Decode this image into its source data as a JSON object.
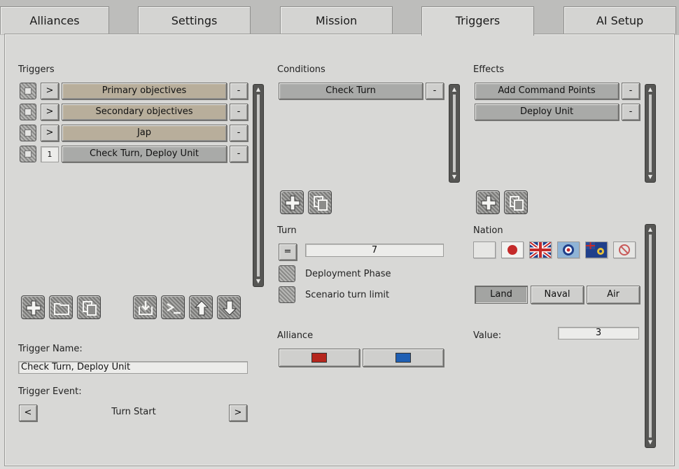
{
  "tabs": [
    {
      "label": "Alliances",
      "active": false
    },
    {
      "label": "Settings",
      "active": false
    },
    {
      "label": "Mission",
      "active": false
    },
    {
      "label": "Triggers",
      "active": true
    },
    {
      "label": "AI Setup",
      "active": false
    }
  ],
  "triggers": {
    "heading": "Triggers",
    "rows": [
      {
        "indicator": ">",
        "name": "Primary objectives",
        "remove": "-"
      },
      {
        "indicator": ">",
        "name": "Secondary objectives",
        "remove": "-"
      },
      {
        "indicator": ">",
        "name": "Jap",
        "remove": "-"
      },
      {
        "indicator": "1",
        "name": "Check Turn, Deploy Unit",
        "remove": "-"
      }
    ],
    "name_label": "Trigger Name:",
    "name_value": "Check Turn, Deploy Unit",
    "event_label": "Trigger Event:",
    "event_prev": "<",
    "event_value": "Turn Start",
    "event_next": ">"
  },
  "conditions": {
    "heading": "Conditions",
    "rows": [
      {
        "name": "Check Turn",
        "remove": "-"
      }
    ]
  },
  "effects": {
    "heading": "Effects",
    "rows": [
      {
        "name": "Add Command Points",
        "remove": "-"
      },
      {
        "name": "Deploy Unit",
        "remove": "-"
      }
    ]
  },
  "turn": {
    "heading": "Turn",
    "operator": "=",
    "value": "7",
    "deployment_phase": "Deployment Phase",
    "scenario_turn_limit": "Scenario turn limit"
  },
  "alliance": {
    "heading": "Alliance",
    "colors": [
      "#b5261d",
      "#1f5fb3"
    ]
  },
  "nation": {
    "heading": "Nation",
    "flags": [
      "blank-flag",
      "japan-flag",
      "uk-flag",
      "raf-roundel-flag",
      "new-zealand-flag",
      "none-flag"
    ],
    "domains": [
      {
        "label": "Land",
        "selected": true
      },
      {
        "label": "Naval",
        "selected": false
      },
      {
        "label": "Air",
        "selected": false
      }
    ],
    "value_label": "Value:",
    "value": "3"
  }
}
